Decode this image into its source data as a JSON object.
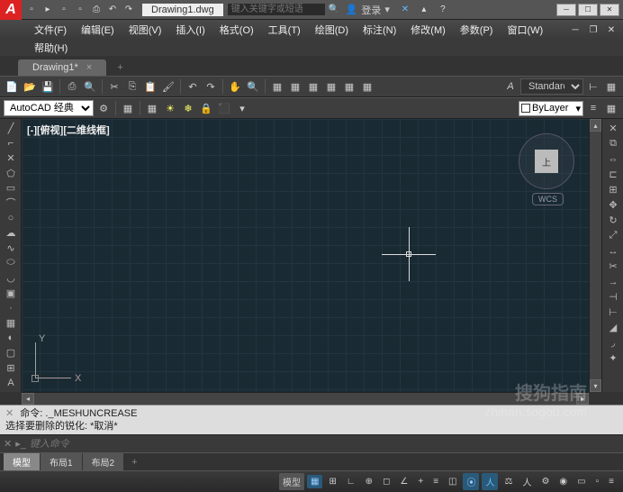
{
  "title": {
    "filename": "Drawing1.dwg",
    "search_placeholder": "键入关键字或短语",
    "login": "登录"
  },
  "menu": {
    "file": "文件(F)",
    "edit": "编辑(E)",
    "view": "视图(V)",
    "insert": "插入(I)",
    "format": "格式(O)",
    "tools": "工具(T)",
    "draw": "绘图(D)",
    "dimension": "标注(N)",
    "modify": "修改(M)",
    "param": "参数(P)",
    "window": "窗口(W)",
    "help": "帮助(H)"
  },
  "tabs": {
    "active": "Drawing1*"
  },
  "workspace": {
    "selected": "AutoCAD 经典"
  },
  "style": {
    "selected": "Standard"
  },
  "layer": {
    "selected": "ByLayer"
  },
  "viewport": {
    "label": "[-][俯视][二维线框]",
    "cube_top": "上",
    "wcs": "WCS"
  },
  "ucs": {
    "x": "X",
    "y": "Y"
  },
  "cmdline": {
    "prefix": "命令:",
    "last": "._MESHUNCREASE",
    "prompt": "选择要删除的锐化:  *取消*"
  },
  "cmdinput": {
    "placeholder": "键入命令"
  },
  "layout": {
    "model": "模型",
    "layout1": "布局1",
    "layout2": "布局2"
  },
  "status": {
    "model": "模型"
  },
  "watermark": {
    "brand": "搜狗指南",
    "url": "zhinan.sogou.com"
  }
}
